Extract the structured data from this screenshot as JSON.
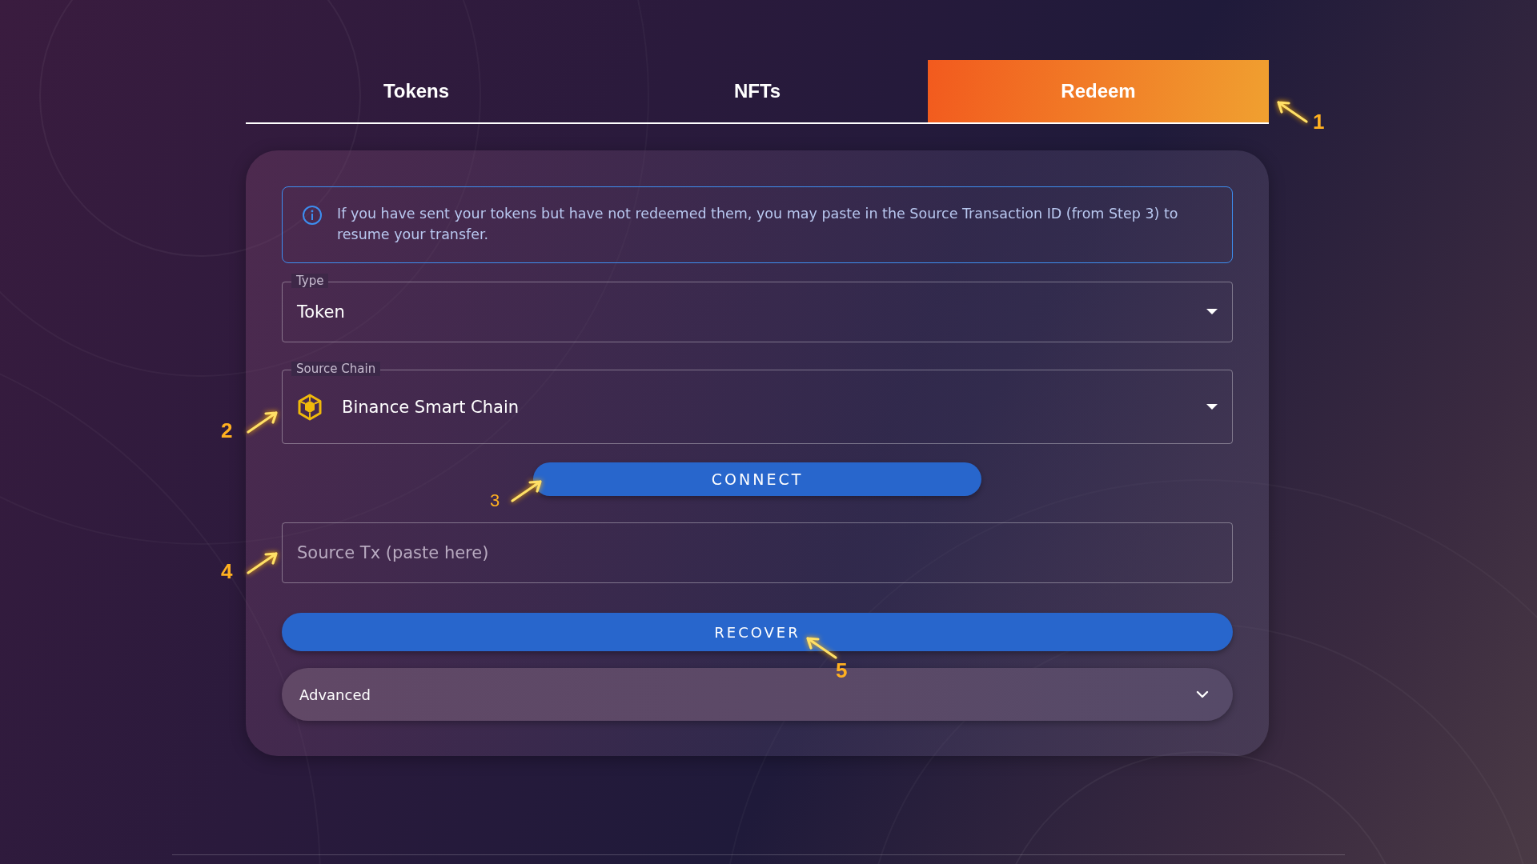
{
  "tabs": [
    {
      "label": "Tokens",
      "selected": false
    },
    {
      "label": "NFTs",
      "selected": false
    },
    {
      "label": "Redeem",
      "selected": true
    }
  ],
  "info": {
    "text": "If you have sent your tokens but have not redeemed them, you may paste in the Source Transaction ID (from Step 3) to resume your transfer."
  },
  "type_field": {
    "label": "Type",
    "value": "Token"
  },
  "source_chain_field": {
    "label": "Source Chain",
    "value": "Binance Smart Chain"
  },
  "connect_button": {
    "label": "CONNECT"
  },
  "source_tx_field": {
    "placeholder": "Source Tx (paste here)"
  },
  "recover_button": {
    "label": "RECOVER"
  },
  "advanced": {
    "label": "Advanced",
    "expanded": false
  },
  "annotations": [
    {
      "number": "1",
      "kind": "up-left"
    },
    {
      "number": "2",
      "kind": "up-right"
    },
    {
      "number": "3",
      "kind": "up-right"
    },
    {
      "number": "4",
      "kind": "up-right"
    },
    {
      "number": "5",
      "kind": "up-left"
    }
  ]
}
